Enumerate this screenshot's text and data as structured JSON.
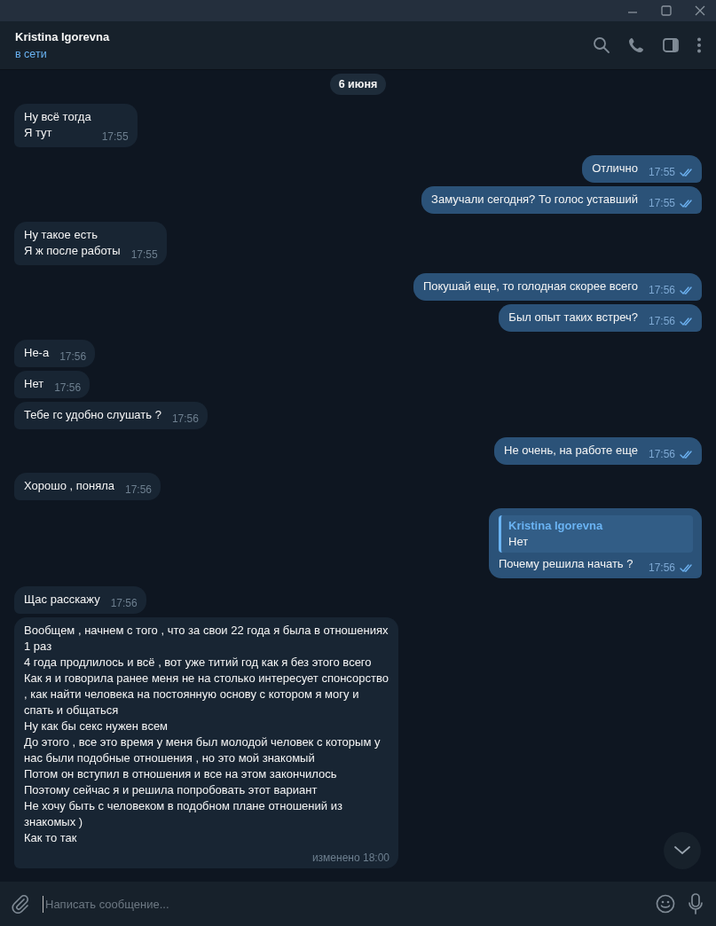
{
  "header": {
    "title": "Kristina Igorevna",
    "status": "в сети"
  },
  "date_separator": "6 июня",
  "messages": [
    {
      "outgoing": false,
      "text": "Ну всё тогда\nЯ тут",
      "time": "17:55"
    },
    {
      "outgoing": true,
      "text": "Отлично",
      "time": "17:55",
      "read": true
    },
    {
      "outgoing": true,
      "text": "Замучали сегодня? То голос уставший",
      "time": "17:55",
      "read": true
    },
    {
      "outgoing": false,
      "text": "Ну такое есть\nЯ ж после работы",
      "time": "17:55"
    },
    {
      "outgoing": true,
      "text": "Покушай еще, то голодная скорее всего",
      "time": "17:56",
      "read": true
    },
    {
      "outgoing": true,
      "text": "Был опыт таких встреч?",
      "time": "17:56",
      "read": true
    },
    {
      "outgoing": false,
      "text": "Не-а",
      "time": "17:56"
    },
    {
      "outgoing": false,
      "text": "Нет",
      "time": "17:56"
    },
    {
      "outgoing": false,
      "text": "Тебе гс удобно слушать ?",
      "time": "17:56"
    },
    {
      "outgoing": true,
      "text": "Не очень, на работе еще",
      "time": "17:56",
      "read": true
    },
    {
      "outgoing": false,
      "text": "Хорошо , поняла",
      "time": "17:56"
    },
    {
      "outgoing": true,
      "reply": {
        "author": "Kristina Igorevna",
        "text": "Нет"
      },
      "text": "Почему решила начать ?",
      "time": "17:56",
      "read": true
    },
    {
      "outgoing": false,
      "text": "Щас расскажу",
      "time": "17:56"
    },
    {
      "outgoing": false,
      "text": "Вообщем , начнем с того , что за свои 22 года я была в отношениях 1 раз\n4 года продлилось и всё , вот уже титий год как я без этого всего\nКак я и говорила ранее меня не на столько интересует спонсорство , как найти человека на постоянную основу с котором я могу и спать и общаться\nНу как бы секс нужен всем\nДо этого , все это время у меня был молодой человек с которым у нас были подобные отношения , но это мой знакомый\nПотом он вступил в отношения и все на этом закончилось\nПоэтому сейчас я и решила попробовать этот вариант\nНе хочу быть с человеком в подобном плане отношений из знакомых )\nКак то так",
      "time": "изменено 18:00"
    }
  ],
  "composer": {
    "placeholder": "Написать сообщение..."
  }
}
